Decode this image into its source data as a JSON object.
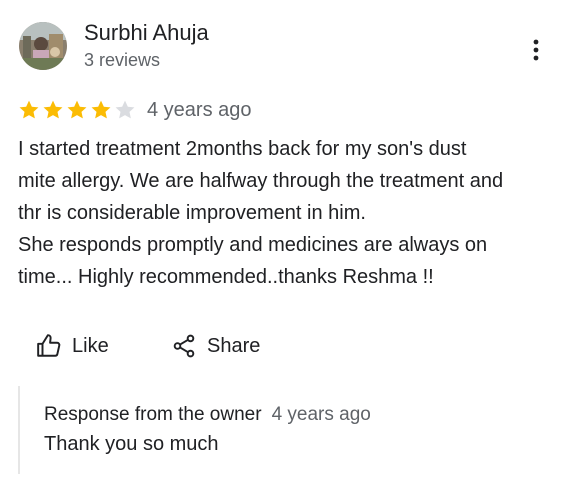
{
  "author": {
    "name": "Surbhi Ahuja",
    "reviews": "3 reviews"
  },
  "review": {
    "rating": 4,
    "rating_max": 5,
    "time": "4 years ago",
    "text": "I started treatment 2months back for my son's dust\nmite allergy. We are halfway through the treatment and\nthr is considerable improvement in him.\nShe responds promptly and medicines are always on\ntime... Highly recommended..thanks Reshma !!"
  },
  "actions": {
    "like_label": "Like",
    "share_label": "Share"
  },
  "owner_response": {
    "title": "Response from the owner",
    "time": "4 years ago",
    "text": "Thank you so much"
  },
  "colors": {
    "star_filled": "#fbbc04",
    "star_empty": "#dadce0",
    "secondary_text": "#5f6368",
    "primary_text": "#202124"
  },
  "icons": {
    "more": "more-vert-icon",
    "like": "thumb-up-icon",
    "share": "share-icon",
    "star": "star-icon"
  }
}
